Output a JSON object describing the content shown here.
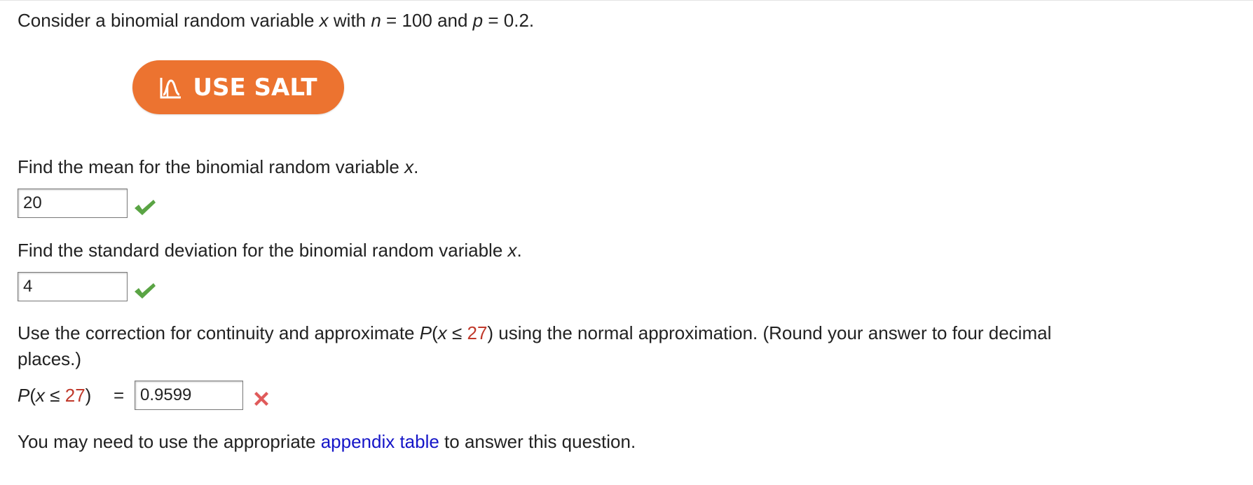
{
  "question": {
    "intro": {
      "prefix": "Consider a binomial random variable ",
      "var": "x",
      "with": " with ",
      "n_symbol": "n",
      "n_eq": " = 100 and ",
      "p_symbol": "p",
      "p_eq": " = 0.2."
    },
    "salt_button": {
      "label": "USE SALT",
      "icon": "salt-curve-icon"
    },
    "part_mean": {
      "prompt": "Find the mean for the binomial random variable ",
      "var": "x",
      "end": ".",
      "answer": "20",
      "status": "correct"
    },
    "part_sd": {
      "prompt": "Find the standard deviation for the binomial random variable ",
      "var": "x",
      "end": ".",
      "answer": "4",
      "status": "correct"
    },
    "part_normal": {
      "prompt_start": "Use the correction for continuity and approximate ",
      "P": "P",
      "open": "(",
      "var": "x",
      "leq": " ≤ ",
      "value": "27",
      "prompt_end": ") using the normal approximation. (Round your answer to four decimal",
      "prompt_line2": "places.)",
      "label_P": "P",
      "label_open": "(",
      "label_var": "x",
      "label_leq": " ≤ ",
      "label_value": "27",
      "label_close": ")",
      "equals": "=",
      "answer": "0.9599",
      "status": "incorrect"
    },
    "footer": {
      "prefix": "You may need to use the appropriate ",
      "link": "appendix table",
      "suffix": " to answer this question."
    }
  },
  "colors": {
    "salt_orange": "#ec7330",
    "check_green": "#5aa444",
    "cross_red": "#e05a5a",
    "highlight_red": "#c0392b",
    "link_blue": "#1515c8"
  }
}
